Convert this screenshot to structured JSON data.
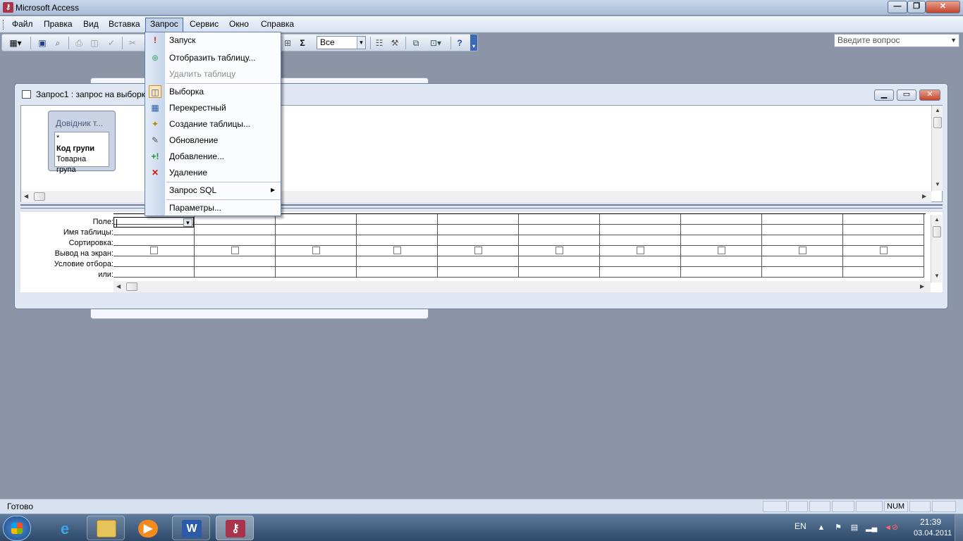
{
  "app": {
    "title": "Microsoft Access",
    "icon": "access-key-icon"
  },
  "menubar": {
    "items": [
      "Файл",
      "Правка",
      "Вид",
      "Вставка",
      "Запрос",
      "Сервис",
      "Окно",
      "Справка"
    ],
    "active_index": 4,
    "help_placeholder": "Введите вопрос"
  },
  "toolbar": {
    "top_values_combo": "Все",
    "sigma": "Σ"
  },
  "query_window": {
    "title": "Запрос1 : запрос на выборку",
    "table_card": {
      "title": "Довідник т...",
      "fields": [
        "*",
        "Код групи",
        "Товарна група"
      ]
    },
    "row_labels": [
      "Поле:",
      "Имя таблицы:",
      "Сортировка:",
      "Вывод на экран:",
      "Условие отбора:",
      "или:"
    ],
    "column_count": 10
  },
  "query_menu": {
    "items": [
      {
        "label": "Запуск",
        "icon": "run-exclamation-icon",
        "disabled": false
      },
      {
        "label": "Отобразить таблицу...",
        "icon": "show-table-icon",
        "disabled": false
      },
      {
        "label": "Удалить таблицу",
        "icon": "",
        "disabled": true
      },
      {
        "label": "Выборка",
        "icon": "select-query-icon",
        "disabled": false,
        "checked": true
      },
      {
        "label": "Перекрестный",
        "icon": "crosstab-query-icon",
        "disabled": false
      },
      {
        "label": "Создание таблицы...",
        "icon": "make-table-query-icon",
        "disabled": false
      },
      {
        "label": "Обновление",
        "icon": "update-query-icon",
        "disabled": false
      },
      {
        "label": "Добавление...",
        "icon": "append-query-icon",
        "disabled": false
      },
      {
        "label": "Удаление",
        "icon": "delete-query-icon",
        "disabled": false
      },
      {
        "label": "Запрос SQL",
        "icon": "",
        "disabled": false,
        "submenu": true
      },
      {
        "label": "Параметры...",
        "icon": "",
        "disabled": false
      }
    ]
  },
  "statusbar": {
    "text": "Готово",
    "num": "NUM"
  },
  "taskbar": {
    "apps": [
      "Internet Explorer",
      "Windows Explorer",
      "Windows Media Player",
      "Microsoft Word",
      "Microsoft Access"
    ],
    "lang": "EN",
    "time": "21:39",
    "date": "03.04.2011"
  },
  "colors": {
    "menu_highlight": "#c3d3ea",
    "workspace": "#8c94a8",
    "taskbar": "#2d4868"
  }
}
